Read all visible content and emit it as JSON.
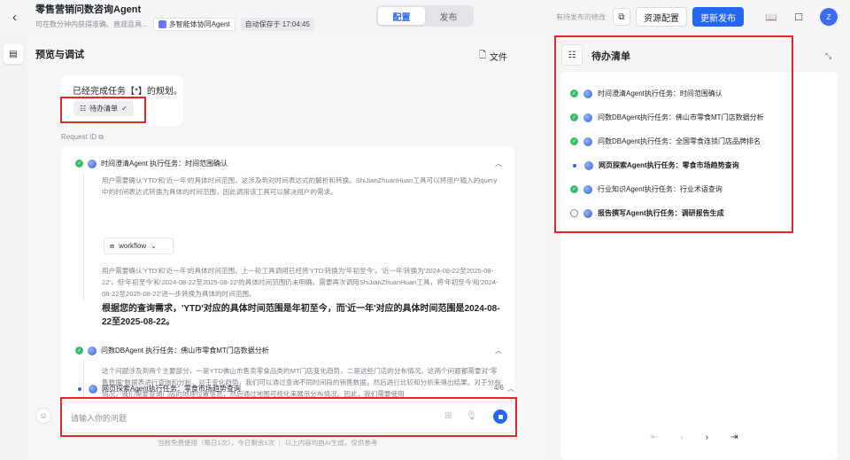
{
  "header": {
    "app_name": "零售营销问数咨询Agent",
    "app_desc": "可在数分钟内获得准确、直观且具...",
    "mode_chip": "多智能体协同Agent",
    "autosave": "自动保存于 17:04:45",
    "tabs": [
      "配置",
      "发布"
    ],
    "pending_text": "有待发布的修改",
    "resource_button": "资源配置",
    "publish_button": "更新发布",
    "avatar_letter": "Z"
  },
  "main": {
    "title": "预览与调试",
    "file_button": "文件",
    "bubble_text": "已经完成任务【*】的规划。",
    "todo_chip": "待办清单",
    "request_id": "Request ID",
    "steps": [
      {
        "title": "时间澄清Agent 执行任务：时间范围确认",
        "para1": "用户需要确认'YTD'和'近一年'的具体时间范围，这涉及到对时间表达式的解析和转换。ShiJianZhuanHuan工具可以将用户输入的query中的时间表达式转换为具体的时间范围，因此调用该工具可以解决用户的需求。",
        "tool_chip": "workflow",
        "para2": "用户需要确认'YTD'和'近一年'的具体时间范围，上一轮工具调用已经将'YTD'转换为'年初至今'，'近一年'转换为'2024-08-22至2025-08-22'，但'年初至今'和'2024-08-22至2025-08-22'的具体时间范围仍未明确，需要再次调用ShiJianZhuanHuan工具，将'年初至今'和'2024-08-22至2025-08-22'进一步转换为具体的时间范围。",
        "answer": "根据您的查询需求，'YTD'对应的具体时间范围是年初至今，而'近一年'对应的具体时间范围是2024-08-22至2025-08-22。"
      },
      {
        "title": "问数DBAgent 执行任务：佛山市零食MT门店数据分析",
        "para1": "这个问题涉及到两个主要部分，一是YTD佛山市售卖零食品类的MT门店变化趋势，二是这些门店的分布情况。这两个问题都需要对\"零售数据\"数据表进行查询和分析。对于变化趋势，我们可以通过查询不同时间段的销售数据，然后进行比较和分析来得出结果。对于分布情况，我们需要查询门店的地理位置信息，然后通过地图可视化来展示分布情况。因此，我们需要使用"
      },
      {
        "title": "网页探索Agent执行任务：零食市场趋势查询",
        "count": "4/6"
      }
    ]
  },
  "input": {
    "placeholder": "请输入你的问题",
    "footer": "当前免费使用（每日1次），今日剩余1次 ｜ 以上内容均由AI生成，仅供参考"
  },
  "todo_panel": {
    "title": "待办清单",
    "items": [
      {
        "text": "时间澄清Agent执行任务：时间范围确认",
        "status": "done"
      },
      {
        "text": "问数DBAgent执行任务：佛山市零食MT门店数据分析",
        "status": "done"
      },
      {
        "text": "问数DBAgent执行任务：全国零食连锁门店品牌排名",
        "status": "done"
      },
      {
        "text": "网页探索Agent执行任务：零食市场趋势查询",
        "status": "running"
      },
      {
        "text": "行业知识Agent执行任务：行业术语查询",
        "status": "done"
      },
      {
        "text": "报告撰写Agent执行任务：调研报告生成",
        "status": "pending"
      }
    ],
    "pager": [
      "⇤",
      "‹",
      "›",
      "⇥"
    ]
  },
  "colors": {
    "accent": "#2468f2",
    "success": "#3dbb6e",
    "highlight": "#e0292c"
  }
}
